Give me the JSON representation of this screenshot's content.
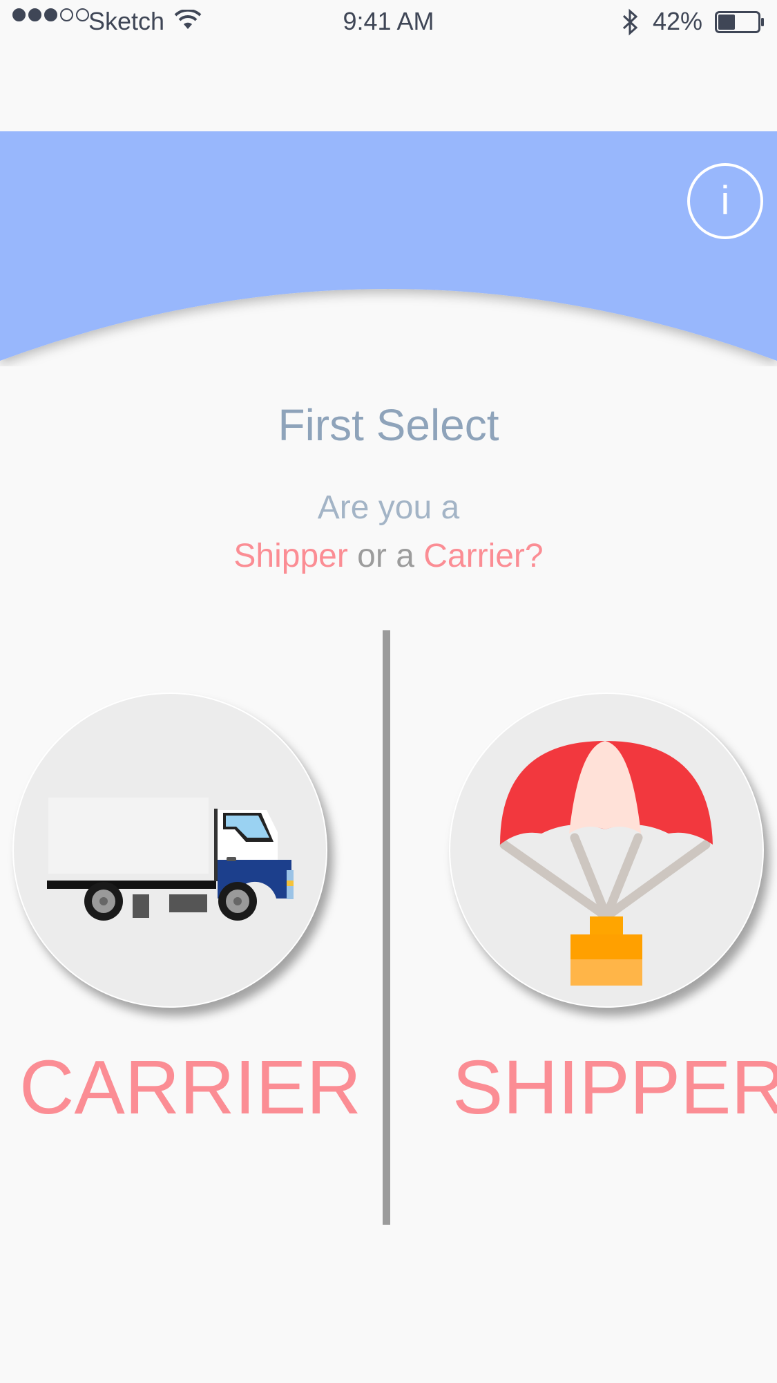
{
  "status_bar": {
    "carrier": "Sketch",
    "time": "9:41 AM",
    "battery": "42%",
    "battery_level": 0.42
  },
  "header": {
    "info_label": "i"
  },
  "content": {
    "title": "First Select",
    "question_line1": "Are you a",
    "question_shipper": "Shipper",
    "question_or": " or a ",
    "question_carrier": "Carrier?"
  },
  "options": {
    "carrier_label": "CARRIER",
    "shipper_label": "SHIPPER"
  },
  "colors": {
    "header_blue": "#98b7fc",
    "accent_pink": "#fb8d94",
    "title_gray_blue": "#8ea3ba"
  }
}
